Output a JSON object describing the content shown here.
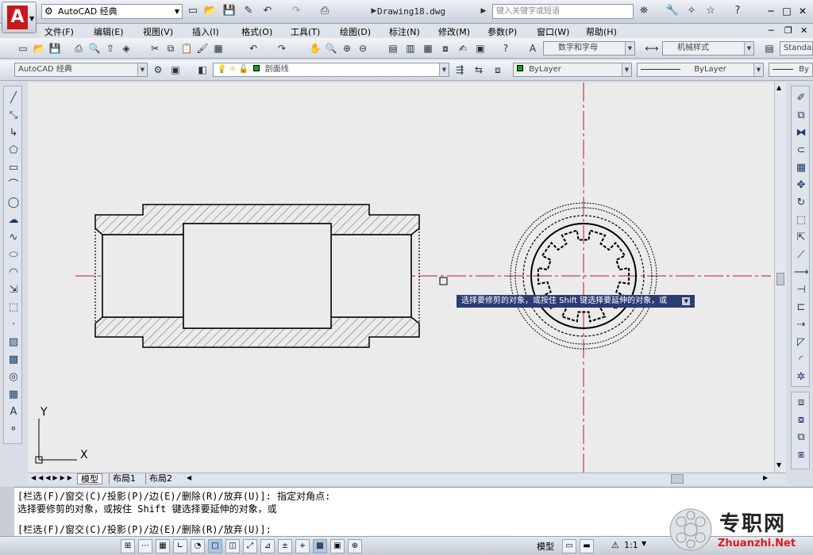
{
  "title_bar": {
    "workspace": "AutoCAD 经典",
    "document": "Drawing18.dwg",
    "search_placeholder": "键入关键字或短语"
  },
  "menu": [
    "文件(F)",
    "编辑(E)",
    "视图(V)",
    "插入(I)",
    "格式(O)",
    "工具(T)",
    "绘图(D)",
    "标注(N)",
    "修改(M)",
    "参数(P)",
    "窗口(W)",
    "帮助(H)"
  ],
  "styles": {
    "text_style": "数字和字母",
    "dim_style": "机械样式",
    "table_style": "Standa"
  },
  "layers": {
    "workspace": "AutoCAD 经典",
    "current_layer": "剖面线",
    "color": "ByLayer",
    "linetype": "ByLayer",
    "lineweight": "By"
  },
  "tooltip": "选择要修剪的对象，或按住 Shift 键选择要延伸的对象，或",
  "ucs": {
    "x_label": "X",
    "y_label": "Y"
  },
  "layout_tabs": [
    "模型",
    "布局1",
    "布局2"
  ],
  "command_lines": [
    "[栏选(F)/窗交(C)/投影(P)/边(E)/删除(R)/放弃(U)]:  指定对角点:",
    "选择要修剪的对象，或按住 Shift 键选择要延伸的对象，或",
    "[栏选(F)/窗交(C)/投影(P)/边(E)/删除(R)/放弃(U)]:"
  ],
  "status": {
    "model": "模型",
    "scale": "1:1"
  },
  "watermark": {
    "text": "专职网",
    "url": "Zhuanzhi.Net"
  },
  "colors": {
    "canvas_bg": "#ECEBEB",
    "hatch": "#3a7a3a",
    "centerline": "#c8102e",
    "tooltip_bg": "#2C3B73",
    "logo_red": "#C8171D"
  }
}
